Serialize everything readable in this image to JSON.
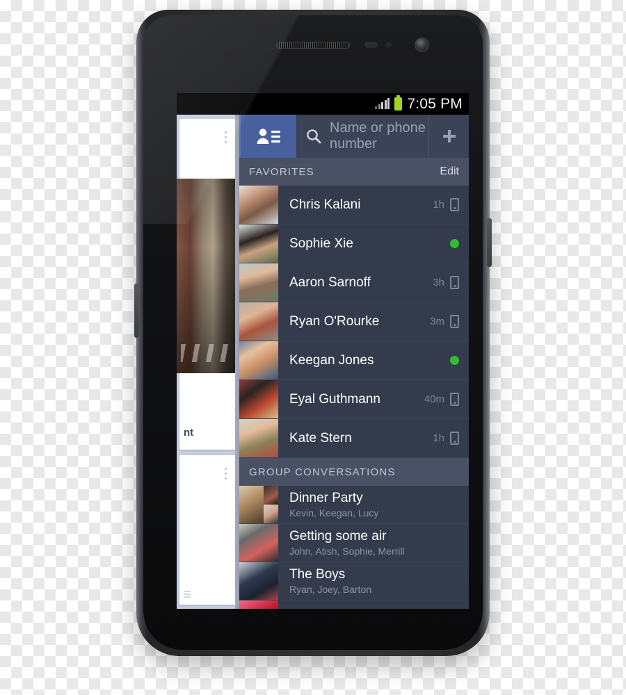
{
  "device": {
    "hardware": {
      "earpiece": "earpiece-grille",
      "proximity_sensor": "proximity-sensor",
      "light_sensor": "light-sensor",
      "front_camera": "front-camera",
      "volume_rocker": "volume-rocker",
      "power_button": "power-button"
    }
  },
  "status_bar": {
    "time": "7:05 PM",
    "signal_icon": "signal-bars-icon",
    "battery_icon": "battery-icon",
    "battery_color": "#9fd420"
  },
  "app_bar": {
    "brand_icon": "contacts-list-icon",
    "brand_color": "#48619e",
    "search_icon": "search-icon",
    "search_value": "",
    "search_placeholder": "Name or phone number",
    "add_icon": "plus-icon"
  },
  "background_screen": {
    "visible_text": "nt",
    "overflow_icon": "overflow-menu-icon"
  },
  "sections": [
    {
      "id": "favorites",
      "title": "FAVORITES",
      "action_label": "Edit",
      "rows": [
        {
          "name": "Chris Kalani",
          "time": "1h",
          "status_icon": "mobile-icon",
          "avatar": "ph1"
        },
        {
          "name": "Sophie Xie",
          "time": "",
          "status_icon": "online-dot",
          "avatar": "ph2"
        },
        {
          "name": "Aaron Sarnoff",
          "time": "3h",
          "status_icon": "mobile-icon",
          "avatar": "ph3"
        },
        {
          "name": "Ryan O'Rourke",
          "time": "3m",
          "status_icon": "mobile-icon",
          "avatar": "ph4"
        },
        {
          "name": "Keegan Jones",
          "time": "",
          "status_icon": "online-dot",
          "avatar": "ph5"
        },
        {
          "name": "Eyal Guthmann",
          "time": "40m",
          "status_icon": "mobile-icon",
          "avatar": "ph6"
        },
        {
          "name": "Kate Stern",
          "time": "1h",
          "status_icon": "mobile-icon",
          "avatar": "ph7"
        }
      ]
    },
    {
      "id": "group-conversations",
      "title": "GROUP CONVERSATIONS",
      "action_label": "",
      "rows": [
        {
          "name": "Dinner Party",
          "members": "Kevin, Keegan, Lucy",
          "avatar": "collage"
        },
        {
          "name": "Getting some air",
          "members": "John, Atish, Sophie, Merrill",
          "avatar": "phg2"
        },
        {
          "name": "The Boys",
          "members": "Ryan, Joey, Barton",
          "avatar": "phg3"
        }
      ]
    }
  ],
  "colors": {
    "panel_bg": "#343b4d",
    "section_header_bg": "#4a5165",
    "app_bar_bg": "#3c4357",
    "online_green": "#2fbf2f",
    "brand_blue": "#48619e"
  }
}
